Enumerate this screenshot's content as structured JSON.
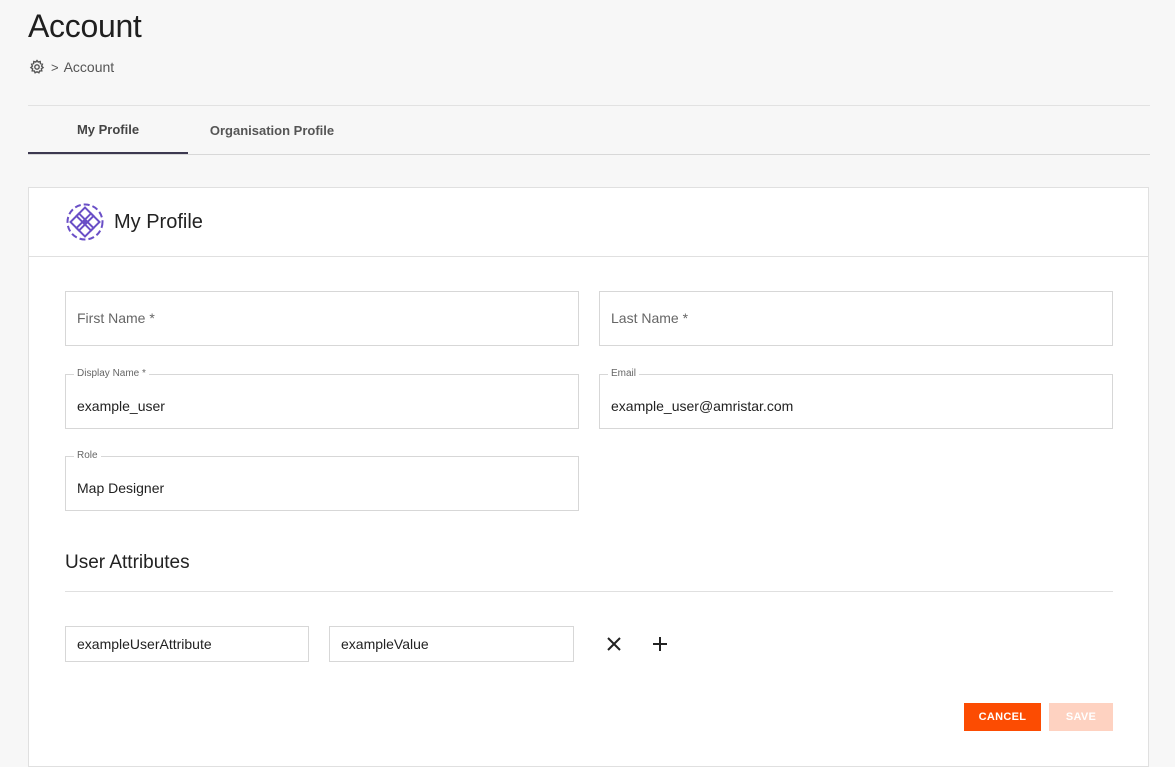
{
  "header": {
    "title": "Account",
    "breadcrumb": {
      "icon": "gear-icon",
      "separator": ">",
      "current": "Account"
    }
  },
  "tabs": [
    {
      "label": "My Profile",
      "active": true
    },
    {
      "label": "Organisation Profile",
      "active": false
    }
  ],
  "profile": {
    "title": "My Profile",
    "logo_icon": "profile-logo-icon",
    "fields": {
      "first_name": {
        "placeholder": "First Name *",
        "value": ""
      },
      "last_name": {
        "placeholder": "Last Name *",
        "value": ""
      },
      "display_name": {
        "label": "Display Name *",
        "value": "example_user"
      },
      "email": {
        "label": "Email",
        "value": "example_user@amristar.com"
      },
      "role": {
        "label": "Role",
        "value": "Map Designer"
      }
    }
  },
  "attributes": {
    "title": "User Attributes",
    "rows": [
      {
        "key": "exampleUserAttribute",
        "value": "exampleValue"
      }
    ],
    "remove_icon": "close-icon",
    "add_icon": "plus-icon"
  },
  "actions": {
    "cancel_label": "CANCEL",
    "save_label": "SAVE"
  },
  "colors": {
    "accent": "#fc4c02",
    "accent_disabled": "#fed2c1",
    "tab_indicator": "#3d3950",
    "logo": "#6a4fc7"
  }
}
